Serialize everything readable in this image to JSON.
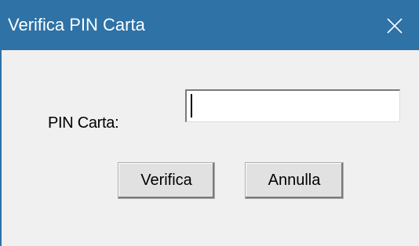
{
  "window": {
    "title": "Verifica PIN Carta",
    "close_icon": "close-icon",
    "title_bar_color": "#2e72a6"
  },
  "form": {
    "pin_label": "PIN Carta:",
    "pin_value": ""
  },
  "buttons": {
    "verify_label": "Verifica",
    "cancel_label": "Annulla"
  }
}
